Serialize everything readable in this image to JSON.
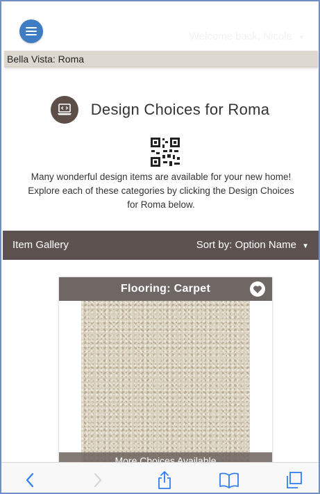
{
  "header": {
    "menu_icon": "hamburger-icon",
    "welcome_text": "Welcome back, Nicole",
    "welcome_caret": "▼"
  },
  "breadcrumb": {
    "text": "Bella Vista: Roma"
  },
  "page": {
    "title": "Design Choices for Roma",
    "title_icon": "laptop-icon",
    "qr_icon": "qr-code-icon",
    "intro": "Many wonderful design items are available for your new home!  Explore each of these categories by clicking the Design Choices for Roma below."
  },
  "gallery": {
    "label": "Item Gallery",
    "sort_label": "Sort by:",
    "sort_value": "Option Name",
    "sort_caret": "▼"
  },
  "card": {
    "title": "Flooring: Carpet",
    "favorite_icon": "heart-icon",
    "footer": "More Choices Available"
  },
  "browser_toolbar": {
    "items": [
      "back-icon",
      "forward-icon",
      "share-icon",
      "bookmarks-icon",
      "tabs-icon"
    ]
  },
  "colors": {
    "accent_blue": "#3e7dc4",
    "gallery_bar": "#5e5250",
    "card_header": "#6f6764",
    "breadcrumb_bg": "#ddd8cf"
  }
}
